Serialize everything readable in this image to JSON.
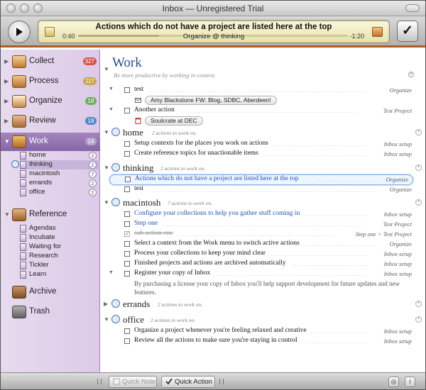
{
  "window": {
    "title": "Inbox — Unregistered Trial"
  },
  "player": {
    "current_action": "Actions which do not have a project are listed here at the top",
    "context_line": "Organize @ thinking",
    "elapsed": "0:40",
    "remaining": "-1:20",
    "progress": 0.3
  },
  "sidebar": {
    "groups": [
      {
        "label": "Collect",
        "count": "327",
        "color": "#d9544f"
      },
      {
        "label": "Process",
        "count": "117",
        "color": "#c7a84a"
      },
      {
        "label": "Organize",
        "count": "18",
        "color": "#6fae5f"
      },
      {
        "label": "Review",
        "count": "18",
        "color": "#4f89c9"
      },
      {
        "label": "Work",
        "count": "14",
        "color": "#b5a2cb"
      },
      {
        "label": "Reference"
      },
      {
        "label": "Archive"
      },
      {
        "label": "Trash"
      }
    ],
    "work_contexts": [
      {
        "label": "home",
        "count": "2"
      },
      {
        "label": "thinking",
        "count": "2"
      },
      {
        "label": "macintosh",
        "count": "7"
      },
      {
        "label": "errands",
        "count": "2"
      },
      {
        "label": "office",
        "count": "2"
      }
    ],
    "reference_items": [
      {
        "label": "Agendas"
      },
      {
        "label": "Incubate"
      },
      {
        "label": "Waiting for"
      },
      {
        "label": "Research"
      },
      {
        "label": "Tickler"
      },
      {
        "label": "Learn"
      }
    ]
  },
  "main": {
    "title": "Work",
    "subtitle": "Be more productive by working in context.",
    "top_actions": [
      {
        "text": "test",
        "note": "Organize"
      },
      {
        "text": "Another action",
        "note": "Test Project"
      }
    ],
    "top_tags": [
      {
        "text": "Amy Blackstone  FW: Blog, SDBC, Aberdeen!"
      },
      {
        "text": "Soulcrate at DEC"
      }
    ],
    "sections": [
      {
        "name": "home",
        "meta": "2 actions to work on.",
        "actions": [
          {
            "text": "Setup contexts for the places you work on actions",
            "note": "Inbox setup"
          },
          {
            "text": "Create reference topics for unactionable items",
            "note": "Inbox setup"
          }
        ]
      },
      {
        "name": "thinking",
        "meta": "2 actions to work on.",
        "actions": [
          {
            "text": "Actions which do not have a project are listed here at the top",
            "note": "Organize"
          },
          {
            "text": "test",
            "note": "Organize"
          }
        ]
      },
      {
        "name": "macintosh",
        "meta": "7 actions to work on.",
        "actions": [
          {
            "text": "Configure your collections to help you gather stuff coming in",
            "note": "Inbox setup"
          },
          {
            "text": "Step one",
            "note": "Test Project"
          },
          {
            "text": "sub action one",
            "note": "Step one > Test Project"
          },
          {
            "text": "Select a context from the Work menu to switch active actions",
            "note": "Organize"
          },
          {
            "text": "Process your collections to keep your mind clear",
            "note": "Inbox setup"
          },
          {
            "text": "Finished projects and actions are archived automatically",
            "note": "Inbox setup"
          },
          {
            "text": "Register your copy of Inbox",
            "note": "Inbox setup"
          }
        ],
        "description": "By purchasing a license your copy of Inbox you'll help support development for future updates and new features."
      },
      {
        "name": "errands",
        "meta": "2 actions to work on."
      },
      {
        "name": "office",
        "meta": "2 actions to work on.",
        "actions": [
          {
            "text": "Organize a project whenever you're feeling relaxed and creative",
            "note": "Inbox setup"
          },
          {
            "text": "Review all the actions to make sure you're staying in control",
            "note": "Inbox setup"
          }
        ]
      }
    ]
  },
  "bottom": {
    "quick_note": "Quick Note",
    "quick_action": "Quick Action"
  }
}
